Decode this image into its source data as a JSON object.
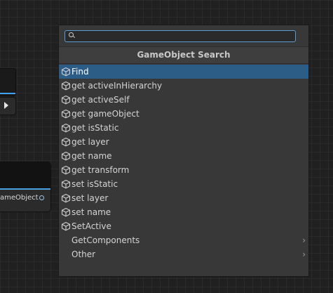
{
  "search": {
    "value": "",
    "placeholder": ""
  },
  "popup": {
    "title": "GameObject Search"
  },
  "items": [
    {
      "label": "Find",
      "icon": "cube-icon",
      "selected": true
    },
    {
      "label": "get activeInHierarchy",
      "icon": "cube-icon"
    },
    {
      "label": "get activeSelf",
      "icon": "cube-icon"
    },
    {
      "label": "get gameObject",
      "icon": "cube-icon"
    },
    {
      "label": "get isStatic",
      "icon": "cube-icon"
    },
    {
      "label": "get layer",
      "icon": "cube-icon"
    },
    {
      "label": "get name",
      "icon": "cube-icon"
    },
    {
      "label": "get transform",
      "icon": "cube-icon"
    },
    {
      "label": "set isStatic",
      "icon": "cube-icon"
    },
    {
      "label": "set layer",
      "icon": "cube-icon"
    },
    {
      "label": "set name",
      "icon": "cube-icon"
    },
    {
      "label": "SetActive",
      "icon": "cube-icon"
    },
    {
      "label": "GetComponents",
      "submenu": true
    },
    {
      "label": "Other",
      "submenu": true
    }
  ],
  "background_node": {
    "port_label": "ameObject"
  },
  "colors": {
    "selection": "#2c5d87",
    "accent": "#41a4f2"
  }
}
